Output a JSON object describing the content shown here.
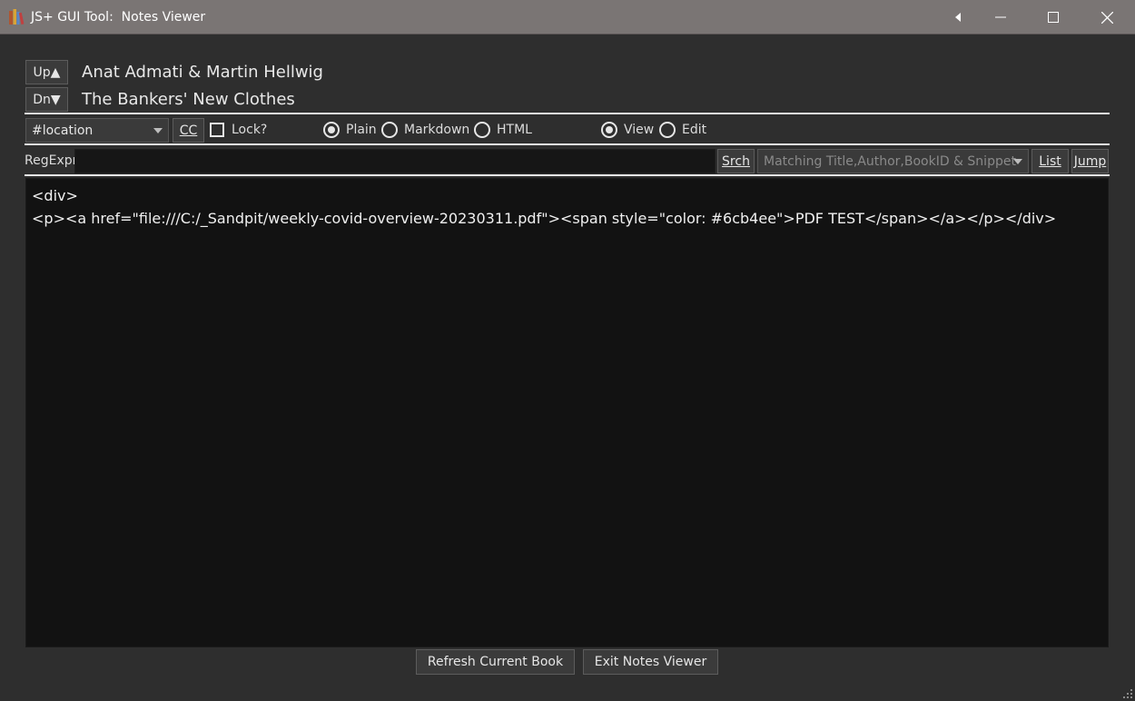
{
  "window": {
    "title": "JS+ GUI Tool:  Notes Viewer",
    "icons": [
      "books-app-icon",
      "collapse-left-icon",
      "minimize-icon",
      "maximize-icon",
      "close-icon"
    ]
  },
  "header": {
    "up_button": "Up▲",
    "down_button": "Dn▼",
    "author": "Anat Admati & Martin Hellwig",
    "book_title": "The Bankers' New Clothes"
  },
  "toolbar": {
    "field_select": "#location",
    "cc_button": "CC",
    "lock_label": "Lock?",
    "lock_checked": false,
    "format_options": [
      "Plain",
      "Markdown",
      "HTML"
    ],
    "format_selected": "Plain",
    "mode_options": [
      "View",
      "Edit"
    ],
    "mode_selected": "View"
  },
  "search": {
    "label": "RegExpr",
    "value": "",
    "search_button": "Srch",
    "match_select": "Matching Title,Author,BookID & Snippet",
    "list_button": "List",
    "jump_button": "Jump"
  },
  "editor": {
    "lines": [
      "<div>",
      "<p><a href=\"file:///C:/_Sandpit/weekly-covid-overview-20230311.pdf\"><span style=\"color: #6cb4ee\">PDF TEST</span></a></p></div>"
    ]
  },
  "footer": {
    "refresh_button": "Refresh Current Book",
    "exit_button": "Exit Notes Viewer"
  },
  "colors": {
    "background": "#2e2e2e",
    "titlebar": "#7a7574",
    "editor_bg": "#121212",
    "text": "#e6e6e6"
  }
}
